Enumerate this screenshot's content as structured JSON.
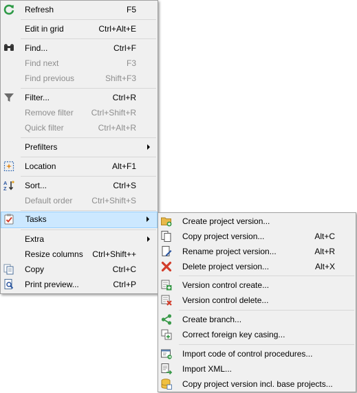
{
  "main_menu": {
    "refresh": {
      "label": "Refresh",
      "shortcut": "F5"
    },
    "edit_grid": {
      "label": "Edit in grid",
      "shortcut": "Ctrl+Alt+E"
    },
    "find": {
      "label": "Find...",
      "shortcut": "Ctrl+F"
    },
    "find_next": {
      "label": "Find next",
      "shortcut": "F3"
    },
    "find_previous": {
      "label": "Find previous",
      "shortcut": "Shift+F3"
    },
    "filter": {
      "label": "Filter...",
      "shortcut": "Ctrl+R"
    },
    "remove_filter": {
      "label": "Remove filter",
      "shortcut": "Ctrl+Shift+R"
    },
    "quick_filter": {
      "label": "Quick filter",
      "shortcut": "Ctrl+Alt+R"
    },
    "prefilters": {
      "label": "Prefilters"
    },
    "location": {
      "label": "Location",
      "shortcut": "Alt+F1"
    },
    "sort": {
      "label": "Sort...",
      "shortcut": "Ctrl+S"
    },
    "default_order": {
      "label": "Default order",
      "shortcut": "Ctrl+Shift+S"
    },
    "tasks": {
      "label": "Tasks"
    },
    "extra": {
      "label": "Extra"
    },
    "resize_columns": {
      "label": "Resize columns",
      "shortcut": "Ctrl+Shift++"
    },
    "copy": {
      "label": "Copy",
      "shortcut": "Ctrl+C"
    },
    "print_preview": {
      "label": "Print preview...",
      "shortcut": "Ctrl+P"
    }
  },
  "tasks_submenu": {
    "create_version": {
      "label": "Create project version..."
    },
    "copy_version": {
      "label": "Copy project version...",
      "shortcut": "Alt+C"
    },
    "rename_version": {
      "label": "Rename project version...",
      "shortcut": "Alt+R"
    },
    "delete_version": {
      "label": "Delete project version...",
      "shortcut": "Alt+X"
    },
    "vc_create": {
      "label": "Version control create..."
    },
    "vc_delete": {
      "label": "Version control delete..."
    },
    "create_branch": {
      "label": "Create branch..."
    },
    "correct_fk": {
      "label": "Correct foreign key casing..."
    },
    "import_code": {
      "label": "Import code of control procedures..."
    },
    "import_xml": {
      "label": "Import XML..."
    },
    "copy_incl_base": {
      "label": "Copy project version incl. base projects..."
    }
  },
  "colors": {
    "highlight": "#cce8ff",
    "highlight_border": "#99d1ff",
    "menu_bg": "#f0f0f0",
    "disabled_text": "#8d8d8d"
  }
}
